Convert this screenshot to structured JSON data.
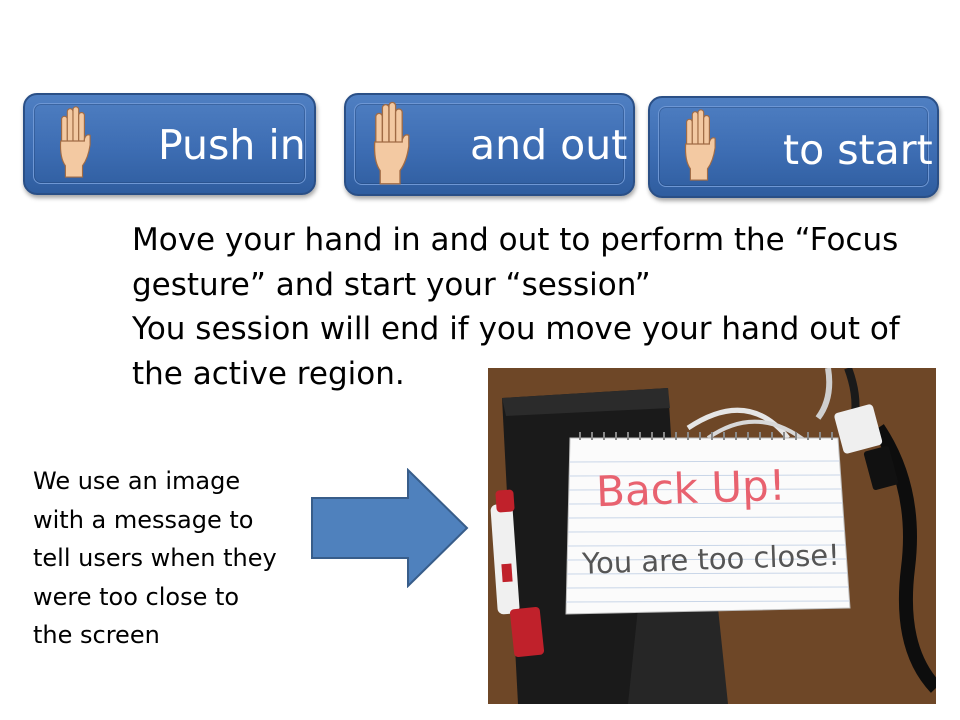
{
  "buttons": [
    {
      "label": "Push in",
      "icon": "raised-hand-icon"
    },
    {
      "label": "and out",
      "icon": "raised-hand-icon"
    },
    {
      "label": "to start",
      "icon": "raised-hand-icon"
    }
  ],
  "main_text": {
    "lines": [
      "Move your hand in and out to perform the “Focus",
      "gesture” and start your “session”",
      "You session will end if you move your hand out of",
      "the active region."
    ]
  },
  "side_text": {
    "lines": [
      "We use an image",
      "with a message to",
      "tell users when they",
      "were too close to",
      "the screen"
    ]
  },
  "arrow": {
    "icon": "right-arrow-icon",
    "color": "#4f81bd"
  },
  "photo": {
    "sign_title": "Back Up!",
    "sign_message": "You are too close!"
  },
  "colors": {
    "button_fill": "#3d6db3",
    "button_text": "#ffffff",
    "sign_title": "#e8626f",
    "sign_message": "#555555"
  }
}
